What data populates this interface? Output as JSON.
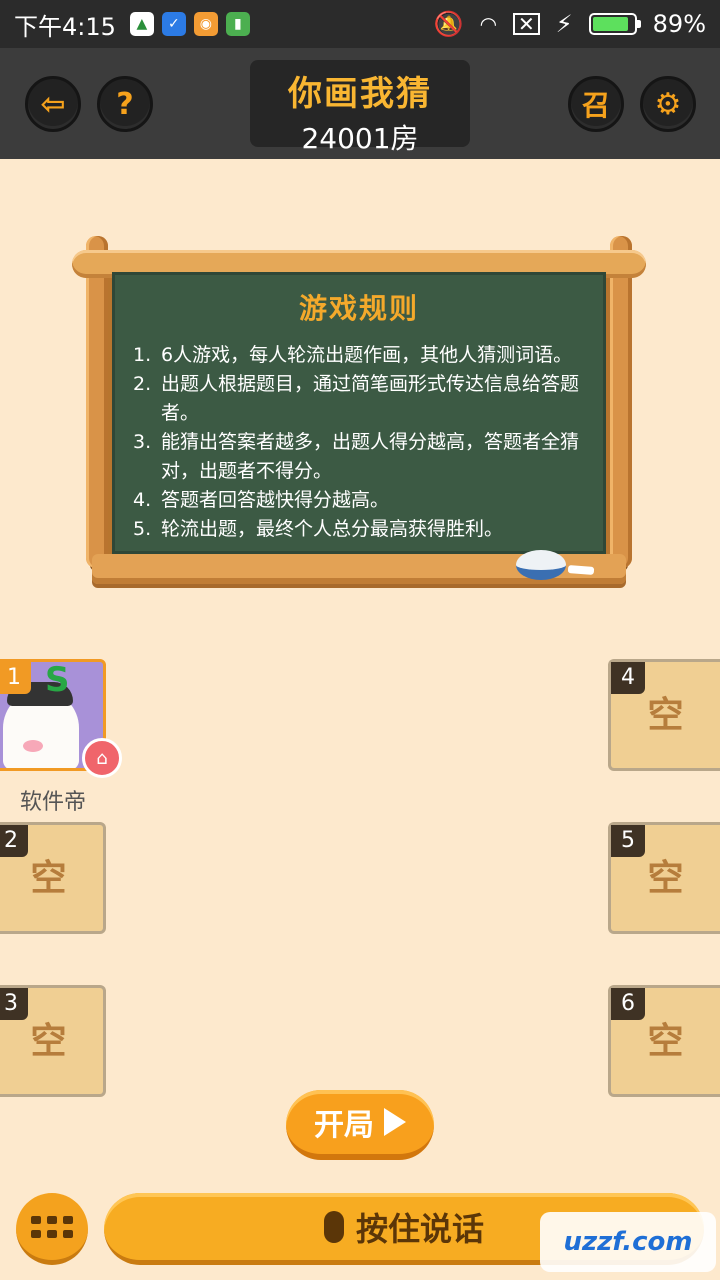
{
  "status_bar": {
    "time": "下午4:15",
    "battery": "89%",
    "battery_level": 0.89
  },
  "header": {
    "title": "你画我猜",
    "room": "24001房",
    "exit_icon": "exit-icon",
    "help_icon": "question-icon",
    "summon_label": "召",
    "settings_icon": "gear-icon"
  },
  "board": {
    "title": "游戏规则",
    "rules": [
      {
        "n": "1.",
        "text": "6人游戏，每人轮流出题作画，其他人猜测词语。"
      },
      {
        "n": "2.",
        "text": "出题人根据题目，通过简笔画形式传达信息给答题者。"
      },
      {
        "n": "3.",
        "text": "能猜出答案者越多，出题人得分越高，答题者全猜对，出题者不得分。"
      },
      {
        "n": "4.",
        "text": "答题者回答越快得分越高。"
      },
      {
        "n": "5.",
        "text": "轮流出题，最终个人总分最高获得胜利。"
      }
    ]
  },
  "seats": {
    "s1": {
      "num": "1",
      "name": "软件帝"
    },
    "s2": {
      "num": "2",
      "label": "空"
    },
    "s3": {
      "num": "3",
      "label": "空"
    },
    "s4": {
      "num": "4",
      "label": "空"
    },
    "s5": {
      "num": "5",
      "label": "空"
    },
    "s6": {
      "num": "6",
      "label": "空"
    }
  },
  "start_button": "开局",
  "talk_button": "按住说话",
  "watermark": "uzzf.com",
  "colors": {
    "background": "#fde9cd",
    "accent": "#f7ac22",
    "board": "#3c5a44",
    "header": "#3c3c3c"
  }
}
